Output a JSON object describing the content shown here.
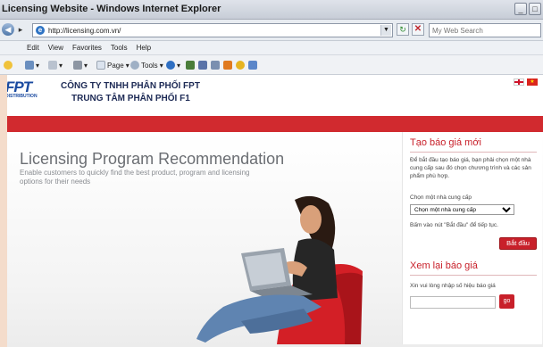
{
  "window": {
    "title": "Licensing Website - Windows Internet Explorer",
    "min_btn": "_",
    "max_btn": "□",
    "close_btn": "x"
  },
  "address_bar": {
    "back": "◀",
    "forward": "▸",
    "url": "http://licensing.com.vn/",
    "dropdown": "▼",
    "refresh": "↻",
    "stop": "✕",
    "search_placeholder": "My Web Search"
  },
  "menu": {
    "items": [
      "Edit",
      "View",
      "Favorites",
      "Tools",
      "Help"
    ]
  },
  "toolbar": {
    "page_label": "Page",
    "tools_label": "Tools"
  },
  "header": {
    "logo_text": "FPT",
    "logo_sub": "DISTRIBUTION",
    "company_line1": "CÔNG TY TNHH PHÂN PHỐI FPT",
    "company_line2": "TRUNG TÂM PHÂN PHỐI F1"
  },
  "hero": {
    "title": "Licensing Program Recommendation",
    "subtitle": "Enable customers to quickly find the best product, program and licensing options for their needs"
  },
  "quote_panel": {
    "heading": "Tạo báo giá mới",
    "intro": "Để bắt đầu tạo báo giá, bạn phải chọn một nhà cung cấp sau đó chọn chương trình và các sản phẩm phù hợp.",
    "select_label": "Chọn một nhà cung cấp",
    "select_value": "Chọn một nhà cung cấp",
    "instruction": "Bấm vào nút \"Bắt đầu\" để tiếp tục.",
    "start_button": "Bắt đầu"
  },
  "review_panel": {
    "heading": "Xem lại báo giá",
    "instruction": "Xin vui lòng nhập số hiệu báo giá",
    "input_value": "",
    "go_button": "go"
  },
  "colors": {
    "accent_red": "#d12a2f",
    "heading_red": "#c8202a",
    "company_text": "#1d2a55"
  }
}
